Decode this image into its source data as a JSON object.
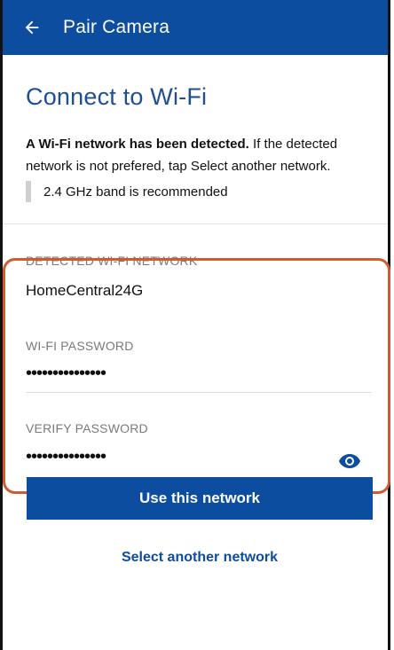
{
  "appbar": {
    "title": "Pair Camera",
    "back_icon": "arrow-left-icon",
    "color": "#0d4da0"
  },
  "main": {
    "heading": "Connect to Wi-Fi",
    "description_bold": "A Wi-Fi network has been detected.",
    "description_rest": " If the detected network is not prefered, tap Select another network.",
    "note": "2.4 GHz band is recommended"
  },
  "detected": {
    "label": "DETECTED WI-FI NETWORK",
    "value": "HomeCentral24G"
  },
  "password": {
    "label": "WI-FI PASSWORD",
    "value": "•••••••••••••••"
  },
  "verify": {
    "label": "VERIFY PASSWORD",
    "value": "•••••••••••••••",
    "toggle_icon": "eye-icon"
  },
  "actions": {
    "primary": "Use this network",
    "secondary": "Select another network"
  },
  "colors": {
    "brand": "#0d4da0",
    "highlight": "#cf5b31",
    "heading": "#1f4f93"
  }
}
